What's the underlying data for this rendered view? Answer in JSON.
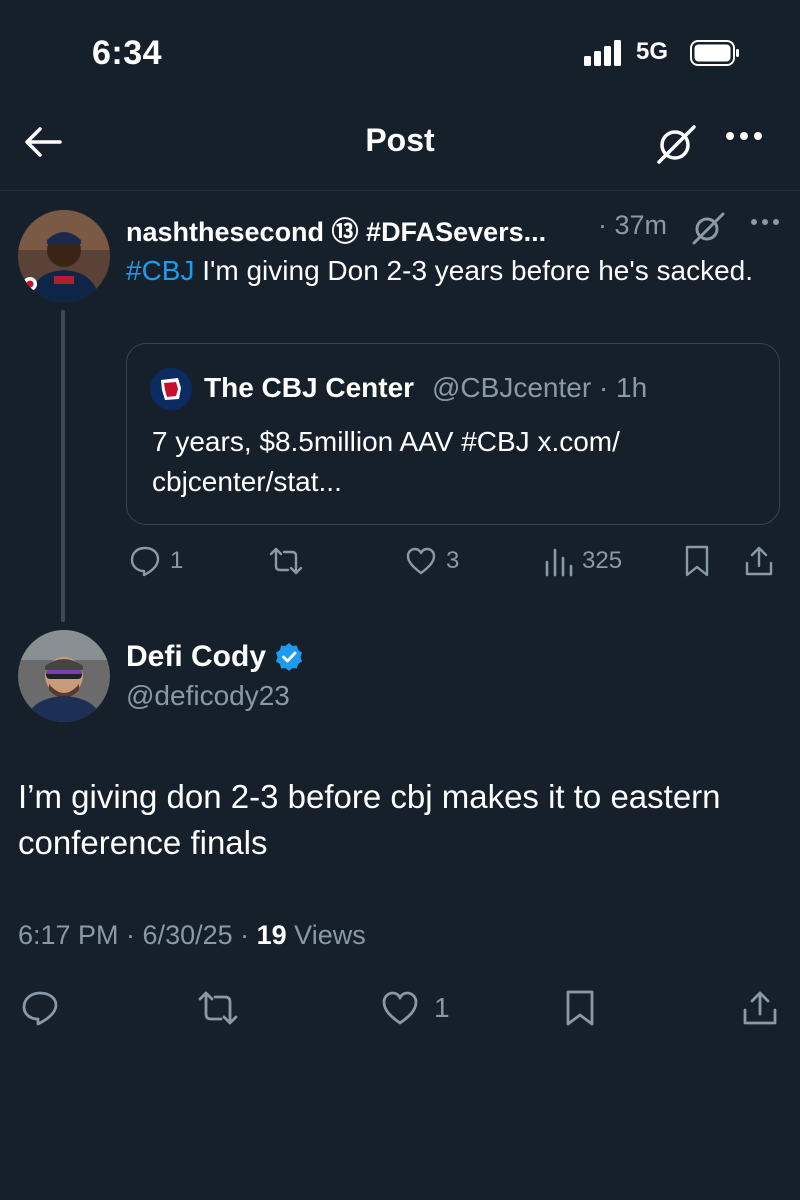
{
  "status_bar": {
    "time": "6:34",
    "network": "5G"
  },
  "header": {
    "title": "Post"
  },
  "reply": {
    "display_name": "nashthesecond ⑬ #DFASevers...",
    "time": "· 37m",
    "hashtag": "#CBJ",
    "text": " I'm giving Don 2-3 years before he's sacked."
  },
  "quote": {
    "name": "The CBJ Center",
    "handle": "@CBJcenter · 1h",
    "text": "7 years, $8.5million AAV #CBJ x.com/ cbjcenter/stat..."
  },
  "reply_actions": {
    "replies": "1",
    "reposts": "",
    "likes": "3",
    "views": "325"
  },
  "main": {
    "display_name": "Defi Cody",
    "handle": "@deficody23",
    "text": "I’m giving don 2-3 before cbj makes it to eastern conference finals",
    "timestamp": "6:17 PM · 6/30/25 · ",
    "views_count": "19",
    "views_label": " Views"
  },
  "main_actions": {
    "likes": "1"
  },
  "colors": {
    "background": "#15202b",
    "accent": "#1d9bf0",
    "muted": "#8b98a5",
    "verified": "#1d9bf0"
  }
}
